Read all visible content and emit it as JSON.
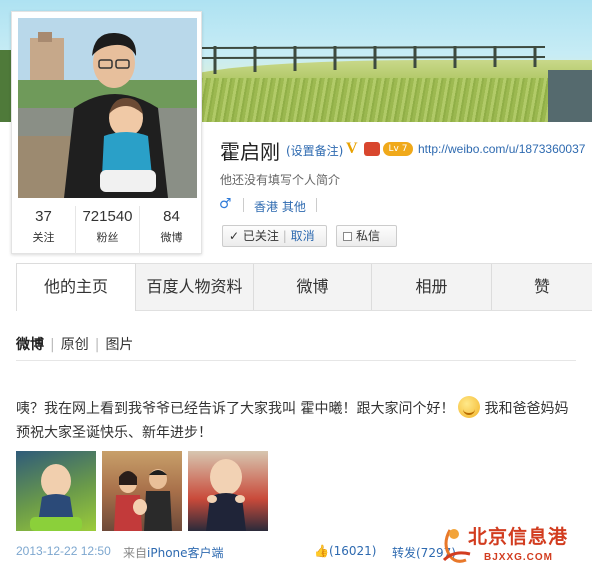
{
  "profile": {
    "name": "霍启刚",
    "remark_link": "(设置备注)",
    "verified_mark": "V",
    "level_badge": "Lv 7",
    "url": "http://weibo.com/u/1873360037",
    "intro": "他还没有填写个人简介",
    "gender_symbol": "♂",
    "region": "香港 其他",
    "stats": [
      {
        "value": "37",
        "label": "关注"
      },
      {
        "value": "721540",
        "label": "粉丝"
      },
      {
        "value": "84",
        "label": "微博"
      }
    ],
    "follow_button": {
      "status": "已关注",
      "cancel": "取消"
    },
    "message_button": "私信"
  },
  "tabs": [
    "他的主页",
    "百度人物资料",
    "微博",
    "相册",
    "赞"
  ],
  "subnav": [
    "微博",
    "原创",
    "图片"
  ],
  "post": {
    "text_part1": "咦？我在网上看到我爷爷已经告诉了大家我叫 霍中曦！跟大家问个好！",
    "text_part2": "我和爸爸妈妈预祝大家圣诞快乐、新年进步！",
    "time": "2013-12-22 12:50",
    "source_prefix": "来自",
    "source_client": "iPhone客户端",
    "likes": "(16021)",
    "forward_label": "转发(7297)"
  },
  "watermark": {
    "text": "北京信息港",
    "url": "BJXXG.COM"
  },
  "colors": {
    "link": "#2e6ab0",
    "timestamp": "#7da7cf",
    "watermark": "#d23c1f",
    "gender": "#2e7ad8"
  }
}
